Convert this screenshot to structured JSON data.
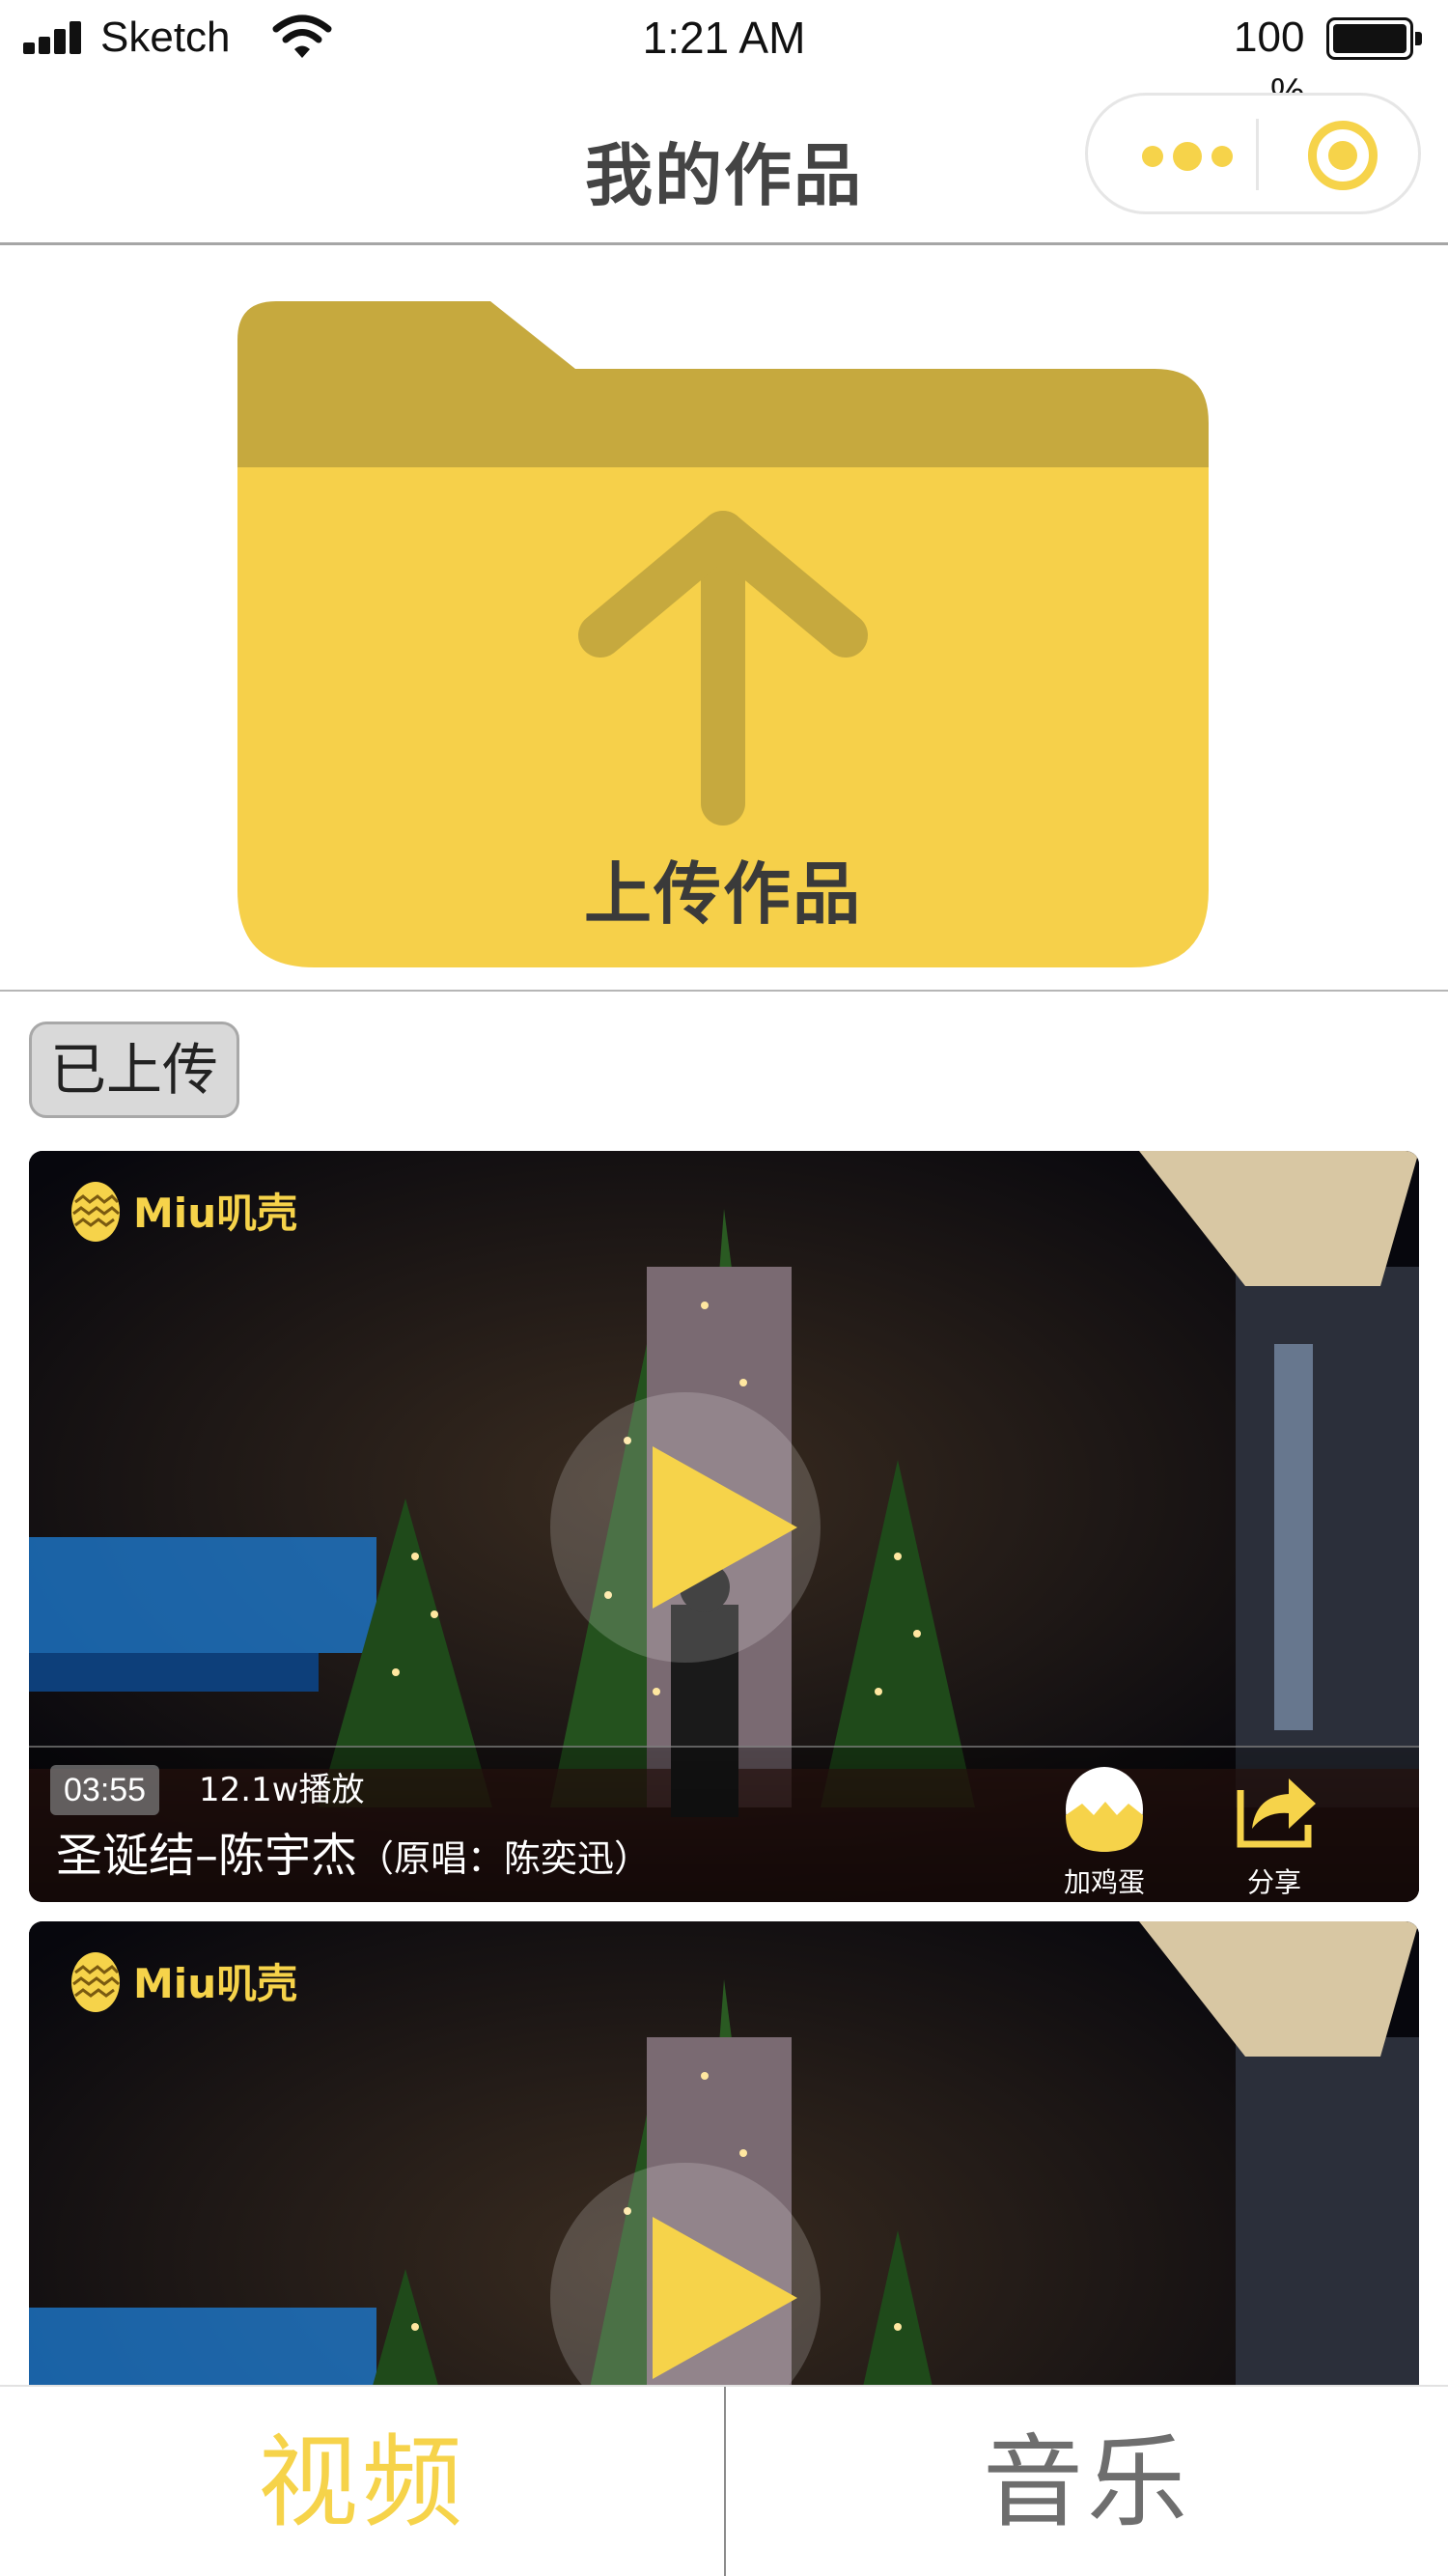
{
  "status_bar": {
    "carrier": "Sketch",
    "time": "1:21 AM",
    "battery_percent": "100",
    "battery_percent_symbol": "%"
  },
  "nav_bar": {
    "title": "我的作品",
    "more_icon": "three-dots-icon",
    "close_icon": "target-circle-icon"
  },
  "upload": {
    "label": "上传作品",
    "icon": "folder-upload-icon"
  },
  "uploaded_tag": "已上传",
  "videos": [
    {
      "logo_text": "Miu叽壳",
      "duration": "03:55",
      "plays": "12.1w播放",
      "title": "圣诞结–陈宇杰",
      "original_singer": "（原唱：陈奕迅）",
      "egg_label": "加鸡蛋",
      "share_label": "分享"
    },
    {
      "logo_text": "Miu叽壳"
    }
  ],
  "tab_bar": {
    "tabs": [
      "视频",
      "音乐"
    ],
    "active": "视频"
  },
  "colors": {
    "accent_yellow": "#f6d34a",
    "folder_tab": "#c6a93e",
    "folder_body": "#f6d04a"
  }
}
